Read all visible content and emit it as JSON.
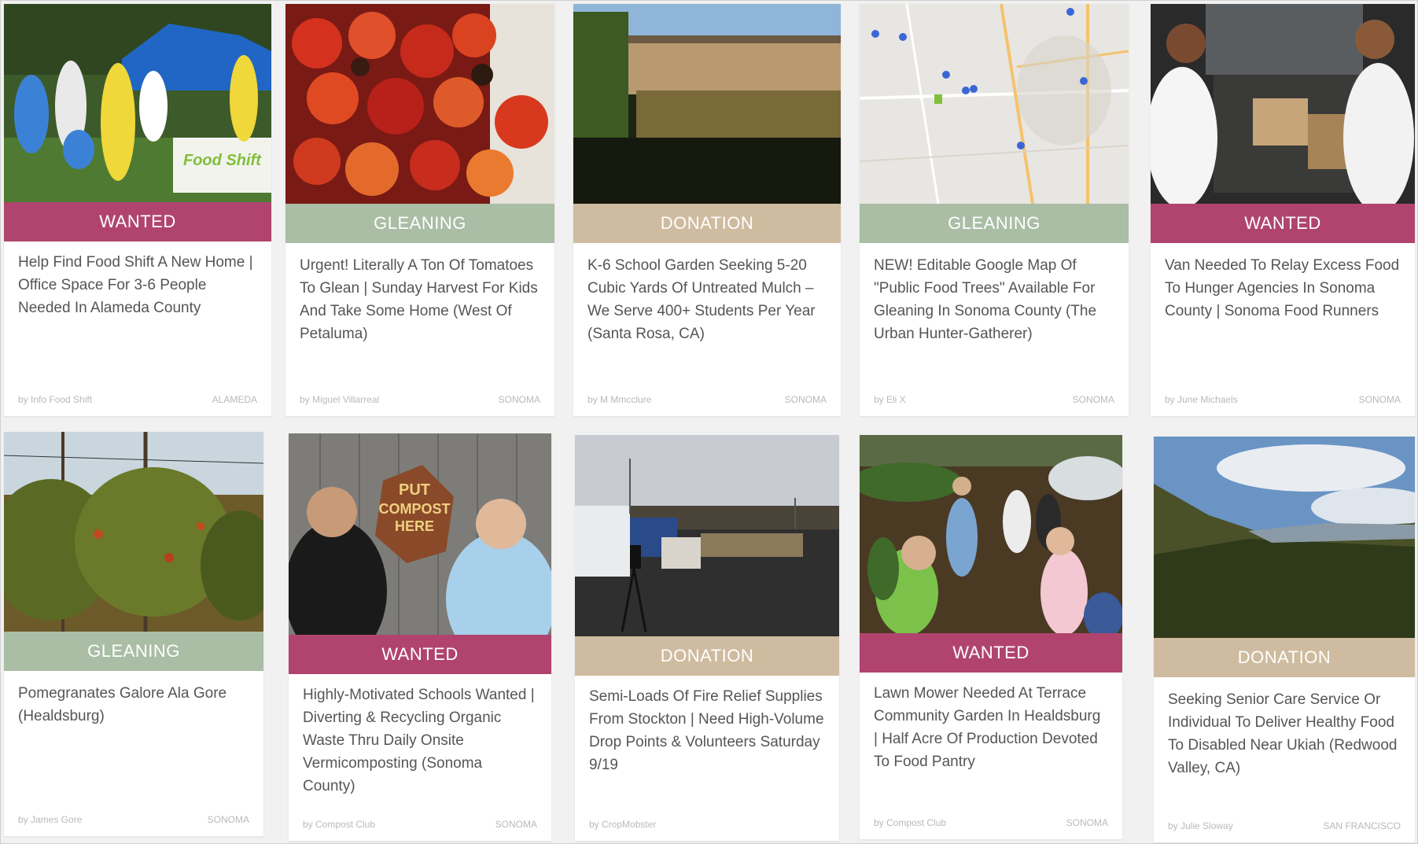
{
  "colors": {
    "wanted": "#b0446f",
    "gleaning": "#a9bea5",
    "donation": "#cfbb9f"
  },
  "cards": [
    {
      "category": "WANTED",
      "title": "Help Find Food Shift A New Home | Office Space For 3-6 People Needed In Alameda County",
      "author": "by Info Food Shift",
      "location": "ALAMEDA",
      "image": "Food Shift volunteers banner photo"
    },
    {
      "category": "GLEANING",
      "title": "Urgent! Literally A Ton Of Tomatoes To Glean | Sunday Harvest For Kids And Take Some Home (West Of Petaluma)",
      "author": "by Miguel Villarreal",
      "location": "SONOMA",
      "image": "tomatoes photo"
    },
    {
      "category": "DONATION",
      "title": "K-6 School Garden Seeking 5-20 Cubic Yards Of Untreated Mulch – We Serve 400+ Students Per Year (Santa Rosa, CA)",
      "author": "by M Mmcclure",
      "location": "SONOMA",
      "image": "school garden photo"
    },
    {
      "category": "GLEANING",
      "title": "NEW! Editable Google Map Of \"Public Food Trees\" Available For Gleaning In Sonoma County (The Urban Hunter-Gatherer)",
      "author": "by Eli X",
      "location": "SONOMA",
      "image": "map screenshot"
    },
    {
      "category": "WANTED",
      "title": "Van Needed To Relay Excess Food To Hunger Agencies In Sonoma County | Sonoma Food Runners",
      "author": "by June Michaels",
      "location": "SONOMA",
      "image": "chefs with van photo"
    },
    {
      "category": "GLEANING",
      "title": "Pomegranates Galore Ala Gore (Healdsburg)",
      "author": "by James Gore",
      "location": "SONOMA",
      "image": "pomegranate trees photo"
    },
    {
      "category": "WANTED",
      "title": "Highly-Motivated Schools Wanted | Diverting & Recycling Organic Waste Thru Daily Onsite Vermicomposting (Sonoma County)",
      "author": "by Compost Club",
      "location": "SONOMA",
      "image": "students with compost sign photo",
      "sign_text": [
        "PUT",
        "COMPOST",
        "HERE"
      ]
    },
    {
      "category": "DONATION",
      "title": "Semi-Loads Of Fire Relief Supplies From Stockton | Need High-Volume Drop Points & Volunteers Saturday 9/19",
      "author": "by CropMobster",
      "location": "",
      "image": "trucks and supplies lot photo"
    },
    {
      "category": "WANTED",
      "title": "Lawn Mower Needed At Terrace Community Garden In Healdsburg | Half Acre Of Production Devoted To Food Pantry",
      "author": "by Compost Club",
      "location": "SONOMA",
      "image": "kids in garden photo"
    },
    {
      "category": "DONATION",
      "title": "Seeking Senior Care Service Or Individual To Deliver Healthy Food To Disabled Near Ukiah (Redwood Valley, CA)",
      "author": "by Julie Sloway",
      "location": "SAN FRANCISCO",
      "image": "valley landscape photo"
    }
  ]
}
